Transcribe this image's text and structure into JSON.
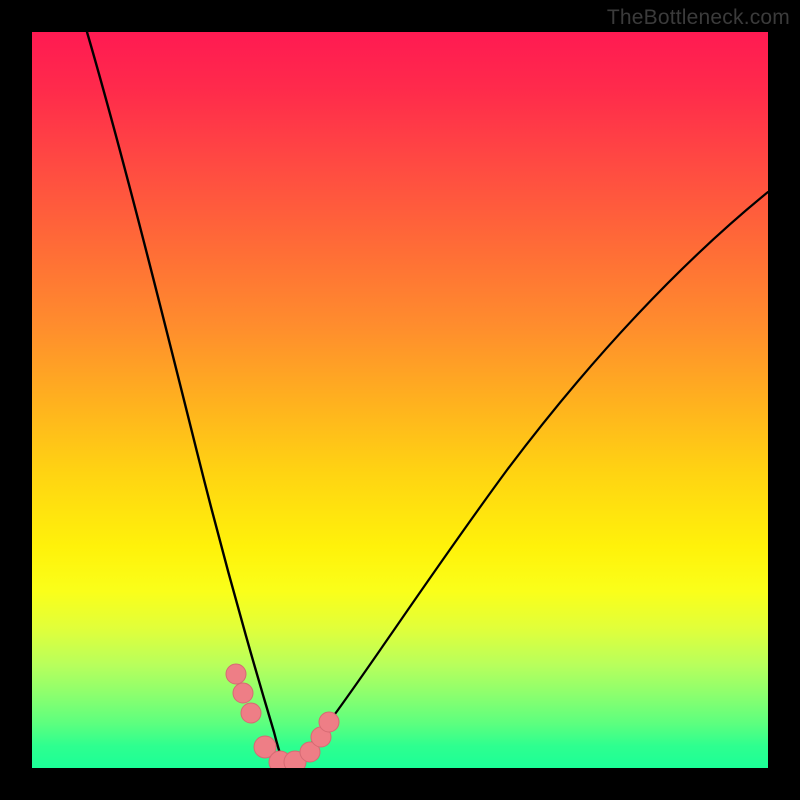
{
  "watermark": {
    "text": "TheBottleneck.com"
  },
  "chart_data": {
    "type": "line",
    "title": "",
    "xlabel": "",
    "ylabel": "",
    "xlim": [
      0,
      100
    ],
    "ylim": [
      0,
      100
    ],
    "grid": false,
    "legend": false,
    "notes": "V-shaped bottleneck curve with gradient red-to-green background. Percent axes implied but not labeled. Vertex near x≈34, y≈0.",
    "series": [
      {
        "name": "left-branch",
        "stroke": "#000000",
        "x": [
          7.5,
          9,
          11,
          13,
          15,
          17,
          19,
          21,
          23,
          25,
          27,
          29,
          31,
          33,
          34
        ],
        "y": [
          100,
          90,
          78,
          67.5,
          58,
          49.5,
          41.5,
          34,
          27,
          20.5,
          14.5,
          9,
          4.5,
          1,
          0
        ]
      },
      {
        "name": "right-branch",
        "stroke": "#000000",
        "x": [
          34,
          36,
          39,
          43,
          48,
          54,
          61,
          69,
          78,
          88,
          99
        ],
        "y": [
          0,
          1,
          3.5,
          8,
          14.5,
          23,
          33,
          44,
          55,
          66.5,
          78
        ]
      },
      {
        "name": "highlight-points",
        "stroke": "#ee7e86",
        "type": "scatter",
        "x": [
          27.5,
          28.5,
          29.5,
          31.5,
          33.5,
          35.5,
          37.5,
          39.0,
          40.0
        ],
        "y": [
          12.5,
          10.0,
          7.5,
          2.5,
          0.5,
          0.5,
          2.0,
          4.0,
          6.0
        ]
      }
    ]
  },
  "colors": {
    "curve": "#000000",
    "marker_fill": "#ee7e86",
    "marker_stroke": "#d66a73"
  }
}
